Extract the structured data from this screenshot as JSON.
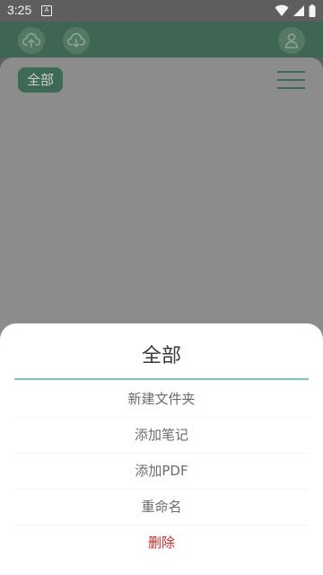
{
  "status_bar": {
    "time": "3:25",
    "a_badge": "A",
    "icons": [
      "wifi-icon",
      "signal-icon",
      "battery-icon"
    ]
  },
  "app_bar": {
    "icons": [
      "upload-icon",
      "download-icon",
      "user-icon"
    ]
  },
  "filter": {
    "label": "全部"
  },
  "sheet": {
    "title": "全部",
    "items": [
      {
        "label": "新建文件夹"
      },
      {
        "label": "添加笔记"
      },
      {
        "label": "添加PDF"
      },
      {
        "label": "重命名"
      },
      {
        "label": "删除"
      }
    ]
  },
  "colors": {
    "primary": "#3e6652",
    "accent": "#7ccab2",
    "danger": "#c62828"
  }
}
